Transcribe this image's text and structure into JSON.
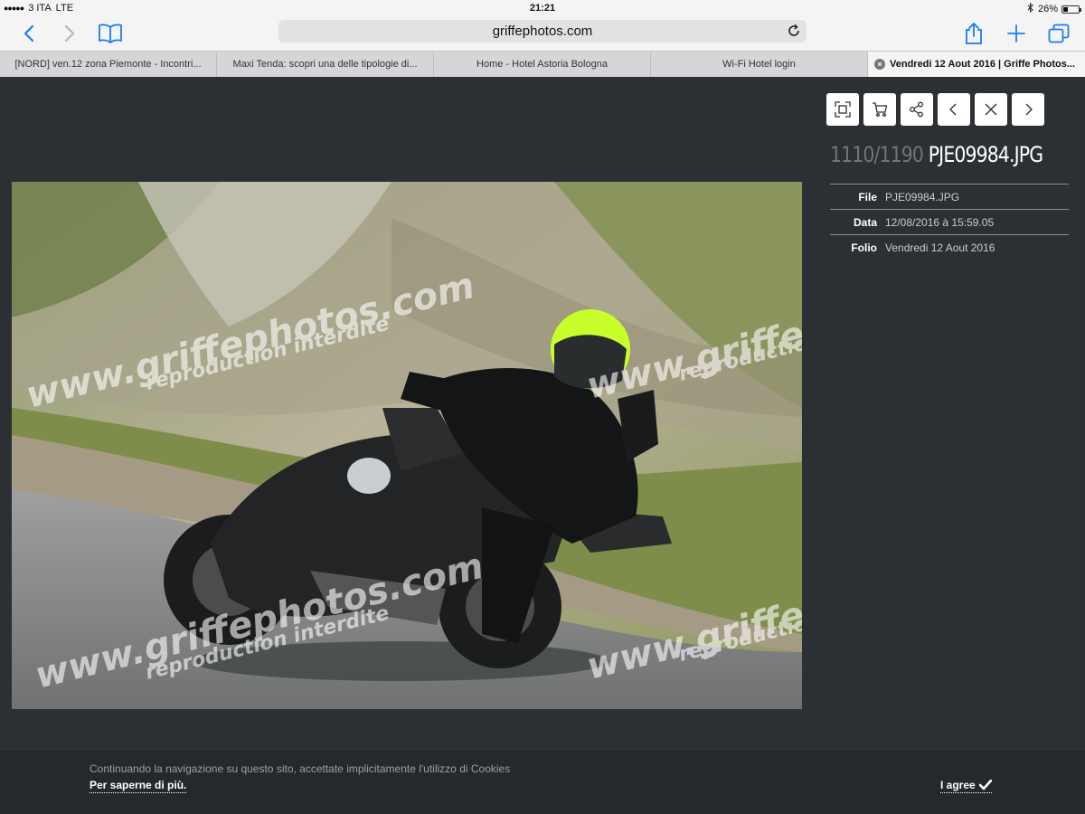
{
  "status_bar": {
    "signal": "●●●●●",
    "carrier": "3 ITA",
    "network": "LTE",
    "time": "21:21",
    "battery": "26%"
  },
  "toolbar": {
    "url": "griffephotos.com"
  },
  "tabs": [
    {
      "label": "[NORD] ven.12 zona Piemonte - Incontri..."
    },
    {
      "label": "Maxi Tenda: scopri una delle tipologie di..."
    },
    {
      "label": "Home - Hotel Astoria Bologna"
    },
    {
      "label": "Wi-Fi Hotel login"
    },
    {
      "label": "Vendredi 12 Aout 2016 | Griffe Photos..."
    }
  ],
  "viewer": {
    "counter": "1110/1190",
    "filename": "PJE09984.JPG",
    "watermark_primary": "www.griffephotos.com",
    "watermark_secondary": "reproduction interdite",
    "meta": [
      {
        "key": "File",
        "value": "PJE09984.JPG"
      },
      {
        "key": "Data",
        "value": "12/08/2016 à 15:59.05"
      },
      {
        "key": "Folio",
        "value": "Vendredi 12 Aout 2016"
      }
    ]
  },
  "cookie": {
    "text": "Continuando la navigazione su questo sito, accettate implicitamente l'utilizzo di Cookies",
    "more": "Per saperne di più.",
    "agree": "I agree"
  }
}
